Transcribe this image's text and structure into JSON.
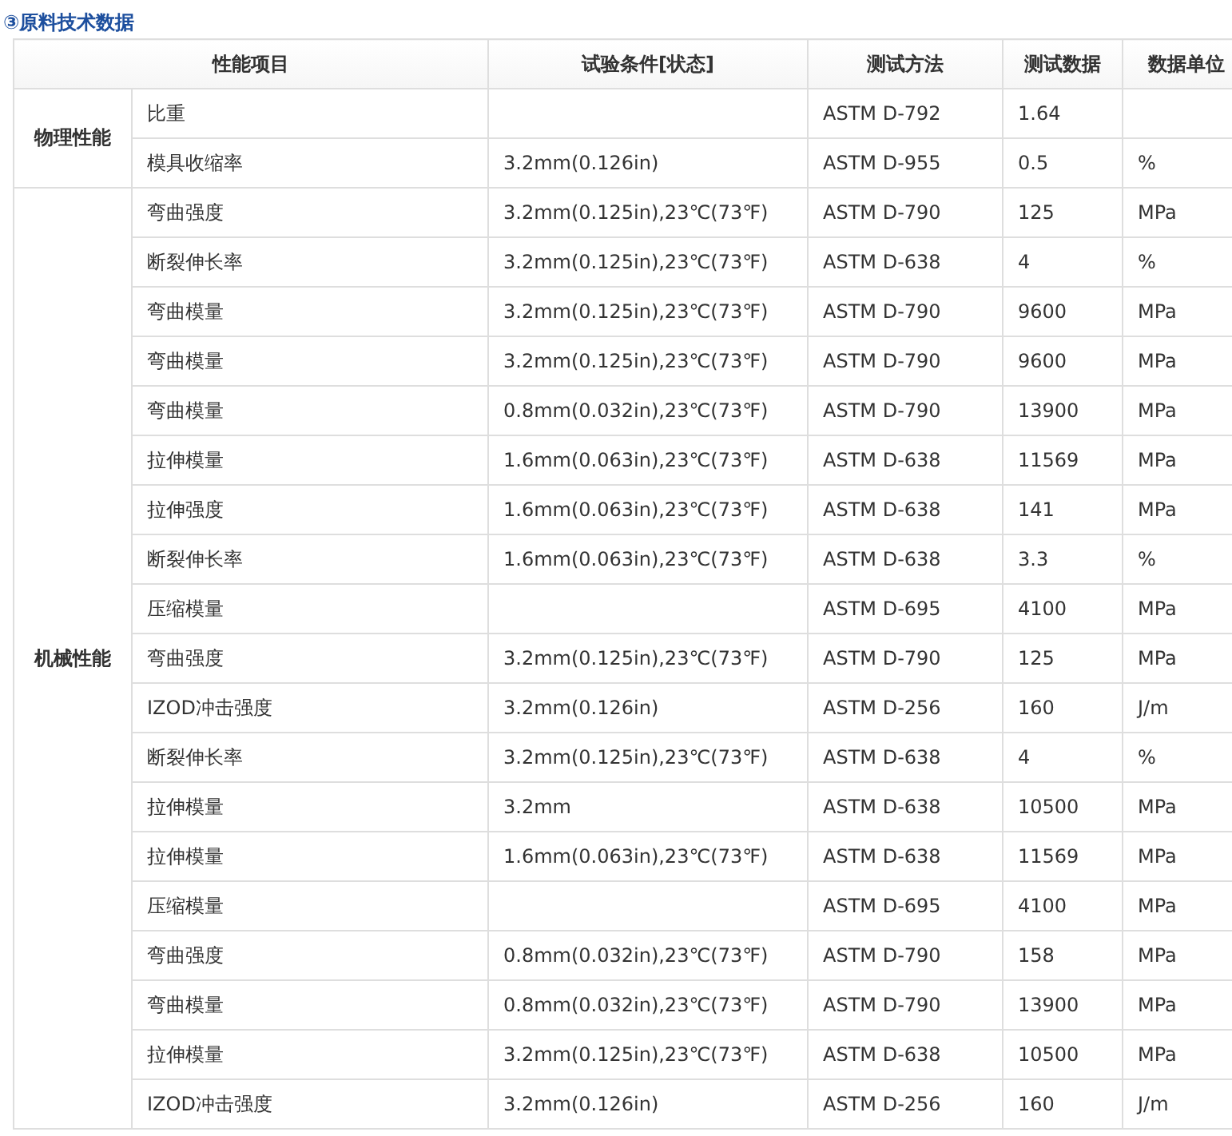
{
  "title": "③原料技术数据",
  "columns": [
    "性能项目",
    "试验条件[状态]",
    "测试方法",
    "测试数据",
    "数据单位"
  ],
  "groups": [
    {
      "name": "物理性能",
      "rows": [
        {
          "item": "比重",
          "condition": "",
          "method": "ASTM D-792",
          "value": "1.64",
          "unit": ""
        },
        {
          "item": "模具收缩率",
          "condition": "3.2mm(0.126in)",
          "method": "ASTM D-955",
          "value": "0.5",
          "unit": "%"
        }
      ]
    },
    {
      "name": "机械性能",
      "rows": [
        {
          "item": "弯曲强度",
          "condition": "3.2mm(0.125in),23℃(73℉)",
          "method": "ASTM D-790",
          "value": "125",
          "unit": "MPa"
        },
        {
          "item": "断裂伸长率",
          "condition": "3.2mm(0.125in),23℃(73℉)",
          "method": "ASTM D-638",
          "value": "4",
          "unit": "%"
        },
        {
          "item": "弯曲模量",
          "condition": "3.2mm(0.125in),23℃(73℉)",
          "method": "ASTM D-790",
          "value": "9600",
          "unit": "MPa"
        },
        {
          "item": "弯曲模量",
          "condition": "3.2mm(0.125in),23℃(73℉)",
          "method": "ASTM D-790",
          "value": "9600",
          "unit": "MPa"
        },
        {
          "item": "弯曲模量",
          "condition": "0.8mm(0.032in),23℃(73℉)",
          "method": "ASTM D-790",
          "value": "13900",
          "unit": "MPa"
        },
        {
          "item": "拉伸模量",
          "condition": "1.6mm(0.063in),23℃(73℉)",
          "method": "ASTM D-638",
          "value": "11569",
          "unit": "MPa"
        },
        {
          "item": "拉伸强度",
          "condition": "1.6mm(0.063in),23℃(73℉)",
          "method": "ASTM D-638",
          "value": "141",
          "unit": "MPa"
        },
        {
          "item": "断裂伸长率",
          "condition": "1.6mm(0.063in),23℃(73℉)",
          "method": "ASTM D-638",
          "value": "3.3",
          "unit": "%"
        },
        {
          "item": "压缩模量",
          "condition": "",
          "method": "ASTM D-695",
          "value": "4100",
          "unit": "MPa"
        },
        {
          "item": "弯曲强度",
          "condition": "3.2mm(0.125in),23℃(73℉)",
          "method": "ASTM D-790",
          "value": "125",
          "unit": "MPa"
        },
        {
          "item": "IZOD冲击强度",
          "condition": "3.2mm(0.126in)",
          "method": "ASTM D-256",
          "value": "160",
          "unit": "J/m"
        },
        {
          "item": "断裂伸长率",
          "condition": "3.2mm(0.125in),23℃(73℉)",
          "method": "ASTM D-638",
          "value": "4",
          "unit": "%"
        },
        {
          "item": "拉伸模量",
          "condition": "3.2mm",
          "method": "ASTM D-638",
          "value": "10500",
          "unit": "MPa"
        },
        {
          "item": "拉伸模量",
          "condition": "1.6mm(0.063in),23℃(73℉)",
          "method": "ASTM D-638",
          "value": "11569",
          "unit": "MPa"
        },
        {
          "item": "压缩模量",
          "condition": "",
          "method": "ASTM D-695",
          "value": "4100",
          "unit": "MPa"
        },
        {
          "item": "弯曲强度",
          "condition": "0.8mm(0.032in),23℃(73℉)",
          "method": "ASTM D-790",
          "value": "158",
          "unit": "MPa"
        },
        {
          "item": "弯曲模量",
          "condition": "0.8mm(0.032in),23℃(73℉)",
          "method": "ASTM D-790",
          "value": "13900",
          "unit": "MPa"
        },
        {
          "item": "拉伸模量",
          "condition": "3.2mm(0.125in),23℃(73℉)",
          "method": "ASTM D-638",
          "value": "10500",
          "unit": "MPa"
        },
        {
          "item": "IZOD冲击强度",
          "condition": "3.2mm(0.126in)",
          "method": "ASTM D-256",
          "value": "160",
          "unit": "J/m"
        }
      ]
    }
  ]
}
